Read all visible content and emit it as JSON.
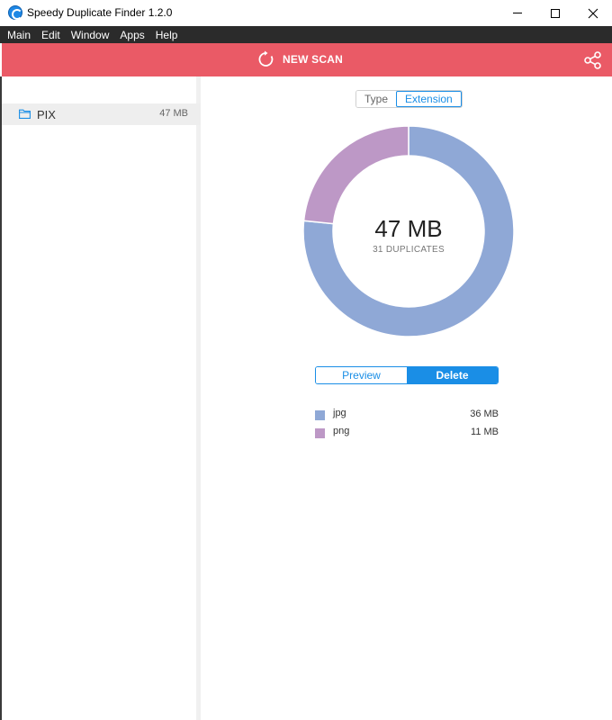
{
  "window": {
    "title": "Speedy Duplicate Finder 1.2.0",
    "controls": [
      "minimize",
      "maximize",
      "close"
    ]
  },
  "menu": {
    "items": [
      "Main",
      "Edit",
      "Window",
      "Apps",
      "Help"
    ]
  },
  "header": {
    "new_scan_label": "NEW SCAN",
    "background": "#ea5a66",
    "icons": [
      "refresh-icon",
      "share-icon"
    ]
  },
  "sidebar": {
    "items": [
      {
        "name": "PIX",
        "size": "47 MB",
        "icon": "folder-icon"
      }
    ]
  },
  "main": {
    "view_toggle": {
      "options": [
        "Type",
        "Extension"
      ],
      "selected": "Extension"
    },
    "summary": {
      "size": "47 MB",
      "count_label": "31 DUPLICATES"
    },
    "actions": {
      "preview_label": "Preview",
      "delete_label": "Delete",
      "selected": "Delete"
    },
    "legend": [
      {
        "label": "jpg",
        "value": "36 MB",
        "color": "#8fa8d6"
      },
      {
        "label": "png",
        "value": "11 MB",
        "color": "#bd98c6"
      }
    ]
  },
  "chart_data": {
    "type": "pie",
    "categories": [
      "jpg",
      "png"
    ],
    "values": [
      36,
      11
    ],
    "colors": [
      "#8fa8d6",
      "#bd98c6"
    ]
  }
}
